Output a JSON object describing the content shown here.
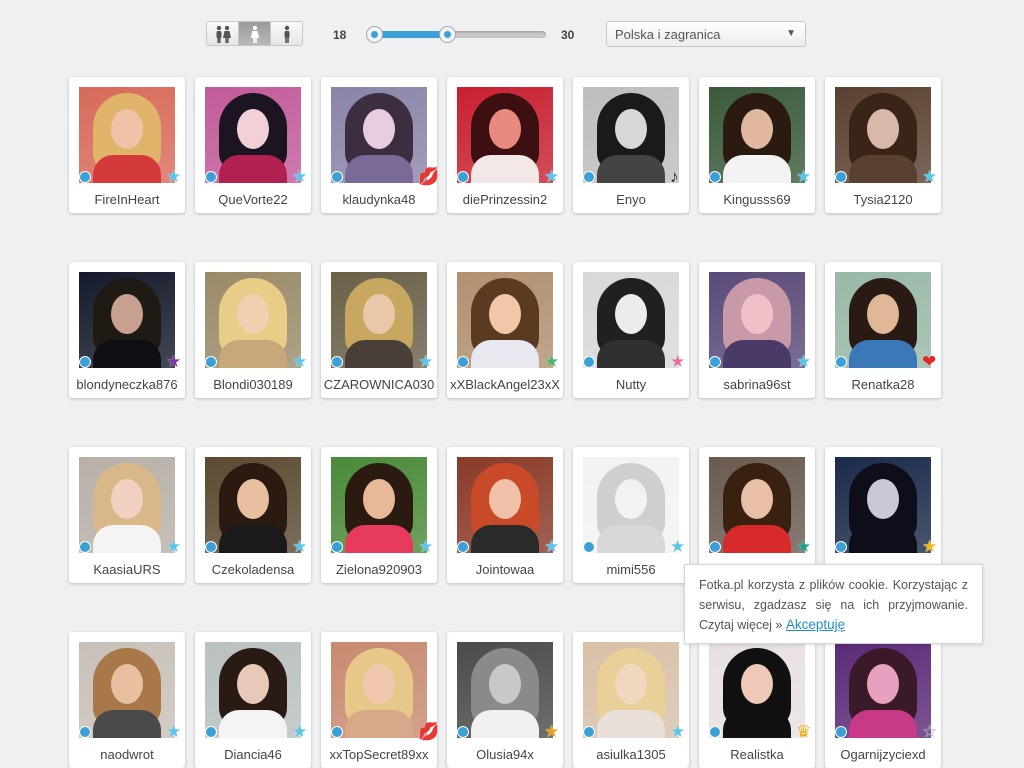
{
  "filters": {
    "gender_buttons": [
      {
        "icon": "couple-icon",
        "active": false
      },
      {
        "icon": "female-icon",
        "active": true
      },
      {
        "icon": "male-icon",
        "active": false
      }
    ],
    "age": {
      "min_label": "18",
      "max_label": "30",
      "range_start": 0.0,
      "range_end": 0.45
    },
    "region": {
      "selected": "Polska i zagranica"
    }
  },
  "colors": {
    "accent": "#3ba0d6",
    "star_blue": "#5cc5e8",
    "link": "#1f8fc9"
  },
  "profiles": [
    {
      "name": "FireInHeart",
      "badge": "star-icon",
      "badge_color": "#5cc5e8",
      "bg": "#d86a5a",
      "hair": "#e0b46a",
      "skin": "#f0c2a8",
      "shirt": "#d43a3a"
    },
    {
      "name": "QueVorte22",
      "badge": "star-icon",
      "badge_color": "#5cc5e8",
      "bg": "#c25a9a",
      "hair": "#1c1420",
      "skin": "#f2d0d8",
      "shirt": "#b02050"
    },
    {
      "name": "klaudynka48",
      "badge": "lips-icon",
      "badge_color": "#e02020",
      "bg": "#8a84a8",
      "hair": "#3c2e40",
      "skin": "#e8cce0",
      "shirt": "#7a6a98"
    },
    {
      "name": "diePrinzessin2",
      "badge": "star-icon",
      "badge_color": "#5cc5e8",
      "bg": "#c82030",
      "hair": "#3c1010",
      "skin": "#e88a80",
      "shirt": "#f2e8e8"
    },
    {
      "name": "Enyo",
      "badge": "music-note-icon",
      "badge_color": "#222222",
      "bg": "#bdbdbd",
      "hair": "#1a1a1a",
      "skin": "#d8d8d8",
      "shirt": "#444444"
    },
    {
      "name": "Kingusss69",
      "badge": "star-icon",
      "badge_color": "#5cc5e8",
      "bg": "#3a5a3a",
      "hair": "#2a1a10",
      "skin": "#e0b8a0",
      "shirt": "#f2f2f2"
    },
    {
      "name": "Tysia2120",
      "badge": "star-icon",
      "badge_color": "#5cc5e8",
      "bg": "#5a4030",
      "hair": "#3a2418",
      "skin": "#d8b8a8",
      "shirt": "#5a4030"
    },
    {
      "name": "blondyneczka876",
      "badge": "star-icon",
      "badge_color": "#7a3aa8",
      "bg": "#141a2a",
      "hair": "#201a14",
      "skin": "#c8a090",
      "shirt": "#0e0e14"
    },
    {
      "name": "Blondi030189",
      "badge": "star-icon",
      "badge_color": "#5cc5e8",
      "bg": "#9a8a68",
      "hair": "#e8cc88",
      "skin": "#f0d0b0",
      "shirt": "#c8a878"
    },
    {
      "name": "CZAROWNICA030",
      "badge": "star-icon",
      "badge_color": "#5cc5e8",
      "bg": "#6a6048",
      "hair": "#c8a860",
      "skin": "#e8c8a8",
      "shirt": "#484038"
    },
    {
      "name": "xXBlackAngel23xX",
      "badge": "star-icon",
      "badge_color": "#48b868",
      "bg": "#b09070",
      "hair": "#5a3a20",
      "skin": "#f0c8a8",
      "shirt": "#e8e8f0"
    },
    {
      "name": "Nutty",
      "badge": "star-icon",
      "badge_color": "#e870a8",
      "bg": "#d8d8d8",
      "hair": "#202020",
      "skin": "#ececec",
      "shirt": "#303030"
    },
    {
      "name": "sabrina96st",
      "badge": "star-icon",
      "badge_color": "#5cc5e8",
      "bg": "#5a4a78",
      "hair": "#c89aa8",
      "skin": "#f0c0c8",
      "shirt": "#4a3a68"
    },
    {
      "name": "Renatka28",
      "badge": "hearts-icon",
      "badge_color": "#e02828",
      "bg": "#98b8a8",
      "hair": "#2a1a14",
      "skin": "#e0b898",
      "shirt": "#3a78b8"
    },
    {
      "name": "KaasiaURS",
      "badge": "star-icon",
      "badge_color": "#5cc5e8",
      "bg": "#b8b0a8",
      "hair": "#d8b888",
      "skin": "#f0d0c0",
      "shirt": "#f4f4f4"
    },
    {
      "name": "Czekoladensa",
      "badge": "star-icon",
      "badge_color": "#5cc5e8",
      "bg": "#5a4a30",
      "hair": "#2a1a10",
      "skin": "#e8c0a0",
      "shirt": "#1a1a1a"
    },
    {
      "name": "Zielona920903",
      "badge": "star-icon",
      "badge_color": "#5cc5e8",
      "bg": "#4a8a38",
      "hair": "#2a1a10",
      "skin": "#e8b898",
      "shirt": "#e83a5a"
    },
    {
      "name": "Jointowaa",
      "badge": "star-icon",
      "badge_color": "#5cc5e8",
      "bg": "#8a3a28",
      "hair": "#c84a28",
      "skin": "#f0c0a8",
      "shirt": "#2a2a2a"
    },
    {
      "name": "mimi556",
      "badge": "star-icon",
      "badge_color": "#5cc5e8",
      "bg": "#f2f2f2",
      "hair": "#cfcfcf",
      "skin": "#f2f2f2",
      "shirt": "#d8d8d8"
    },
    {
      "name": "",
      "badge": "star-icon",
      "badge_color": "#20a088",
      "bg": "#6a5a50",
      "hair": "#3a2010",
      "skin": "#e8c0a8",
      "shirt": "#d82a2a"
    },
    {
      "name": "",
      "badge": "star-icon",
      "badge_color": "#f0b820",
      "bg": "#1a2a4a",
      "hair": "#0e0e1a",
      "skin": "#c8c8d8",
      "shirt": "#0e0e1a"
    },
    {
      "name": "naodwrot",
      "badge": "star-icon",
      "badge_color": "#5cc5e8",
      "bg": "#c8c0b8",
      "hair": "#a87848",
      "skin": "#e8c0a0",
      "shirt": "#4a4a4a"
    },
    {
      "name": "Diancia46",
      "badge": "star-icon",
      "badge_color": "#5cc5e8",
      "bg": "#b8c0c0",
      "hair": "#2a1a14",
      "skin": "#e8c8b8",
      "shirt": "#f4f4f4"
    },
    {
      "name": "xxTopSecret89xx",
      "badge": "lips-icon",
      "badge_color": "#e02020",
      "bg": "#c88a70",
      "hair": "#e8c888",
      "skin": "#f0c8b0",
      "shirt": "#d8a888"
    },
    {
      "name": "Olusia94x",
      "badge": "star-icon",
      "badge_color": "#e8a020",
      "bg": "#4a4a48",
      "hair": "#8a8a88",
      "skin": "#c8c8c8",
      "shirt": "#f0f0f0"
    },
    {
      "name": "asiulka1305",
      "badge": "star-icon",
      "badge_color": "#5cc5e8",
      "bg": "#d8c0a8",
      "hair": "#e8d098",
      "skin": "#f0d8c0",
      "shirt": "#e8e0d8"
    },
    {
      "name": "Realistka",
      "badge": "crown-icon",
      "badge_color": "#e8b020",
      "bg": "#e8e0e0",
      "hair": "#101010",
      "skin": "#f0c8b8",
      "shirt": "#101010"
    },
    {
      "name": "Ogarnijzyciexd",
      "badge": "star-outline-icon",
      "badge_color": "#9a9a9a",
      "bg": "#5a2a78",
      "hair": "#3a1a28",
      "skin": "#e8a0c0",
      "shirt": "#c83a88"
    }
  ],
  "cookie_notice": {
    "text": "Fotka.pl korzysta z plików cookie. Korzystając z serwisu, zgadzasz się na ich przyjmowanie. Czytaj więcej »",
    "accept_link": "Akceptuję"
  }
}
